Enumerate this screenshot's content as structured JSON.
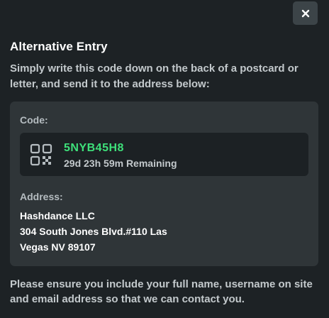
{
  "modal": {
    "title": "Alternative Entry",
    "instructions": "Simply write this code down on the back of a postcard or letter, and send it to the address below:",
    "close_icon": "close-x-icon",
    "footer_note": "Please ensure you include your full name, username on site and email address so that we can contact you."
  },
  "code_section": {
    "label": "Code:",
    "icon": "qr-code-icon",
    "code": "5NYB45H8",
    "remaining": "29d 23h 59m Remaining"
  },
  "address_section": {
    "label": "Address:",
    "lines": [
      "Hashdance LLC",
      "304 South Jones Blvd.#110 Las",
      "Vegas NV 89107"
    ]
  },
  "colors": {
    "background": "#1d2225",
    "card": "#2f3538",
    "code_box": "#1c2124",
    "code_accent": "#3ee07a",
    "close_button": "#3c4448"
  }
}
